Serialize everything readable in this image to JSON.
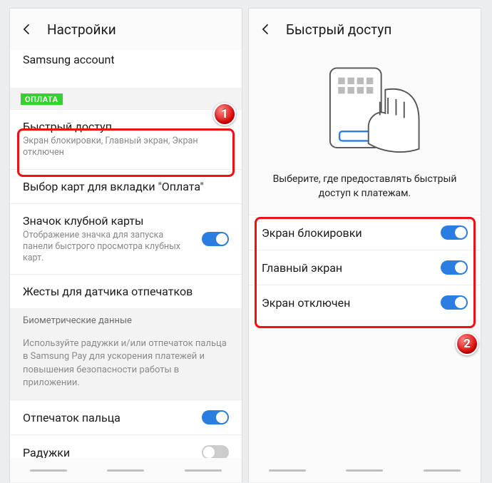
{
  "left": {
    "header_title": "Настройки",
    "samsung_account": "Samsung account",
    "pay_label": "ОПЛАТА",
    "quick_access": {
      "title": "Быстрый доступ",
      "sub": "Экран блокировки, Главный экран, Экран отключен"
    },
    "card_select": "Выбор карт для вкладки \"Оплата\"",
    "club_icon": {
      "title": "Значок клубной карты",
      "sub": "Отображение значка для запуска панели быстрого просмотра клубных карт."
    },
    "gestures": "Жесты для датчика отпечатков",
    "bio_header": "Биометрические данные",
    "bio_hint": "Используйте радужки и/или отпечаток пальца в Samsung Pay для ускорения платежей и повышения безопасности работы в приложении.",
    "fingerprint": "Отпечаток пальца",
    "iris": "Радужки",
    "badge": "1"
  },
  "right": {
    "header_title": "Быстрый доступ",
    "caption": "Выберите, где предоставлять быстрый доступ к платежам.",
    "opt1": "Экран блокировки",
    "opt2": "Главный экран",
    "opt3": "Экран отключен",
    "badge": "2"
  }
}
